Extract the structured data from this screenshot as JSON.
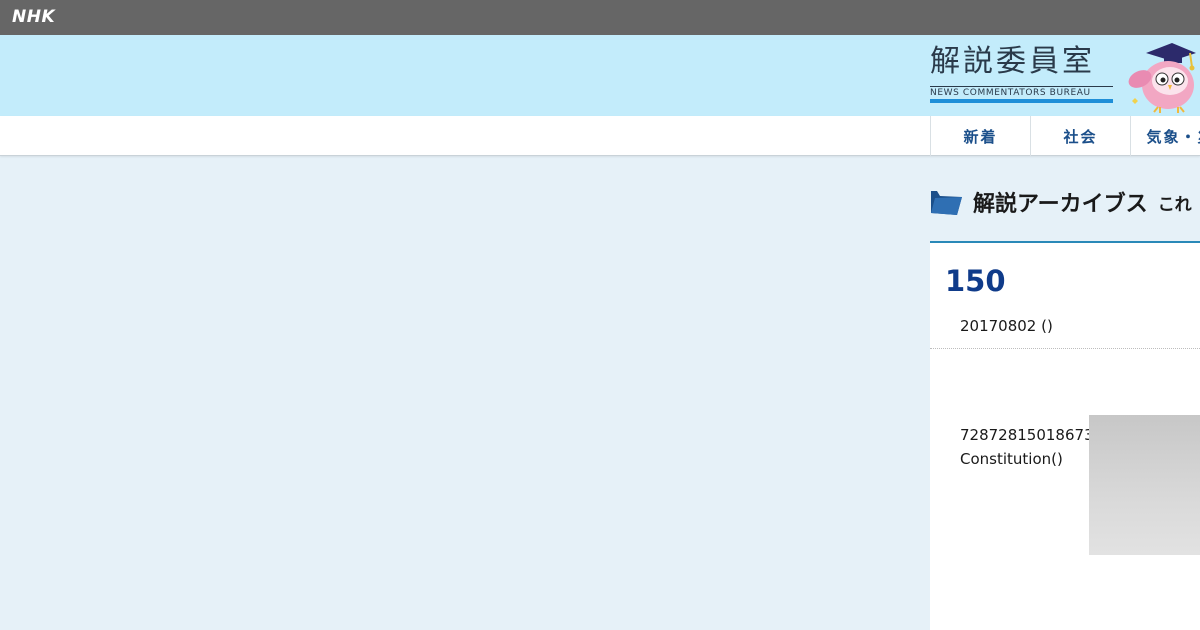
{
  "topbar": {
    "logo_text": "NHK"
  },
  "banner": {
    "title": "解説委員室",
    "subtitle": "NEWS COMMENTATORS BUREAU",
    "mascot_icon": "owl-mascot-icon",
    "background": "#c3ecfb"
  },
  "nav": {
    "items": [
      {
        "label": "新着"
      },
      {
        "label": "社会"
      },
      {
        "label": "気象・災"
      }
    ],
    "color": "#1b4f8a"
  },
  "section": {
    "icon": "folder-icon",
    "title": "解説アーカイブス",
    "more_text": "これ"
  },
  "article": {
    "title": "150",
    "date": "20170802 ()",
    "body": "72872815018673The English Constitution()"
  }
}
